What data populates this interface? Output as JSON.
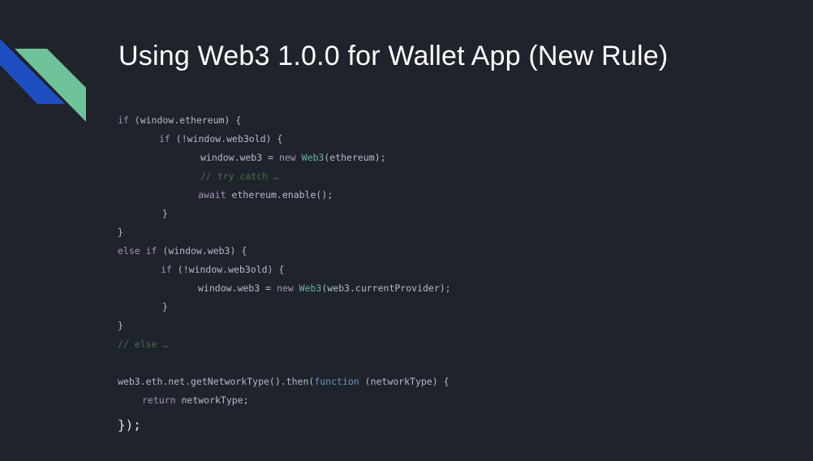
{
  "slide": {
    "title": "Using Web3 1.0.0 for Wallet App (New Rule)"
  },
  "code": {
    "l1": {
      "kw": "if",
      "rest": " (window.ethereum) {"
    },
    "l2": {
      "kw": "if",
      "rest": " (!window.web3old) {"
    },
    "l3": {
      "a": "window.web3 = ",
      "kw": "new",
      "sp": " ",
      "cls": "Web3",
      "b": "(ethereum);"
    },
    "l4": {
      "cm": "// try catch …"
    },
    "l5": {
      "kw": "await",
      "rest": " ethereum.enable();"
    },
    "l6": {
      "t": "}"
    },
    "l7": {
      "t": "}"
    },
    "l8": {
      "kw": "else if",
      "rest": " (window.web3) {"
    },
    "l9": {
      "kw": "if",
      "rest": " (!window.web3old) {"
    },
    "l10": {
      "a": "window.web3 = ",
      "kw": "new",
      "sp": " ",
      "cls": "Web3",
      "b": "(web3.currentProvider);"
    },
    "l11": {
      "t": "}"
    },
    "l12": {
      "t": "}"
    },
    "l13": {
      "cm": "// else …"
    },
    "l14": {
      "a": "web3.eth.net.getNetworkType().then(",
      "fn": "function",
      "b": " (networkType) {"
    },
    "l15": {
      "kw": "return",
      "rest": " networkType;"
    },
    "l16": {
      "t": "});"
    }
  },
  "colors": {
    "background": "#1f232b",
    "accent_blue": "#1e4fc2",
    "accent_green": "#6fc39a"
  }
}
